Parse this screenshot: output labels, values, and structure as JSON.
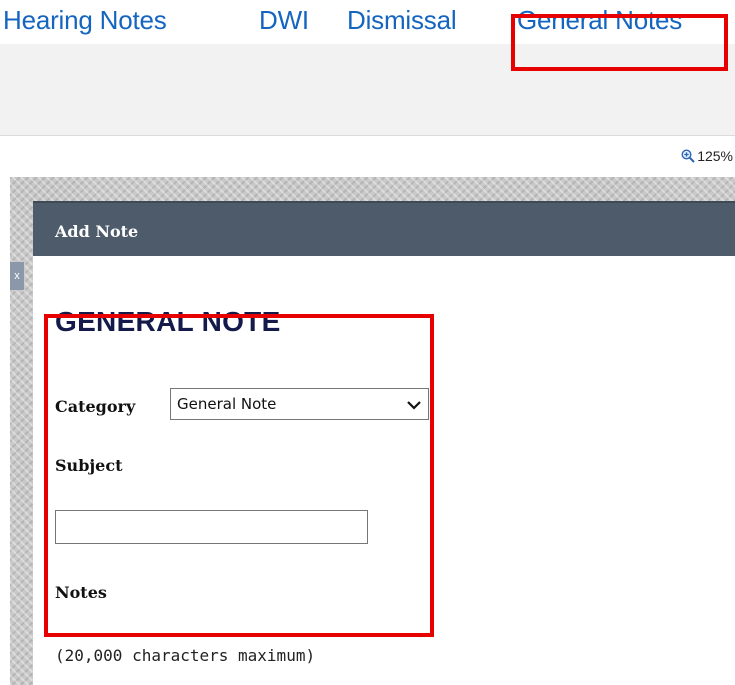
{
  "tabs": {
    "hearing_notes": "Hearing Notes",
    "dwi": "DWI",
    "dismissal": "Dismissal",
    "general_notes": "General Notes"
  },
  "zoom": {
    "label": "125%",
    "icon": "zoom-in-icon"
  },
  "dialog": {
    "title": "Add Note",
    "heading": "GENERAL NOTE",
    "category": {
      "label": "Category",
      "selected": "General Note"
    },
    "subject": {
      "label": "Subject",
      "value": ""
    },
    "notes": {
      "label": "Notes",
      "hint": "(20,000 characters maximum)"
    }
  },
  "colors": {
    "tab_link": "#1565c0",
    "dialog_header": "#4e5b6b",
    "annotation": "#e60000"
  }
}
